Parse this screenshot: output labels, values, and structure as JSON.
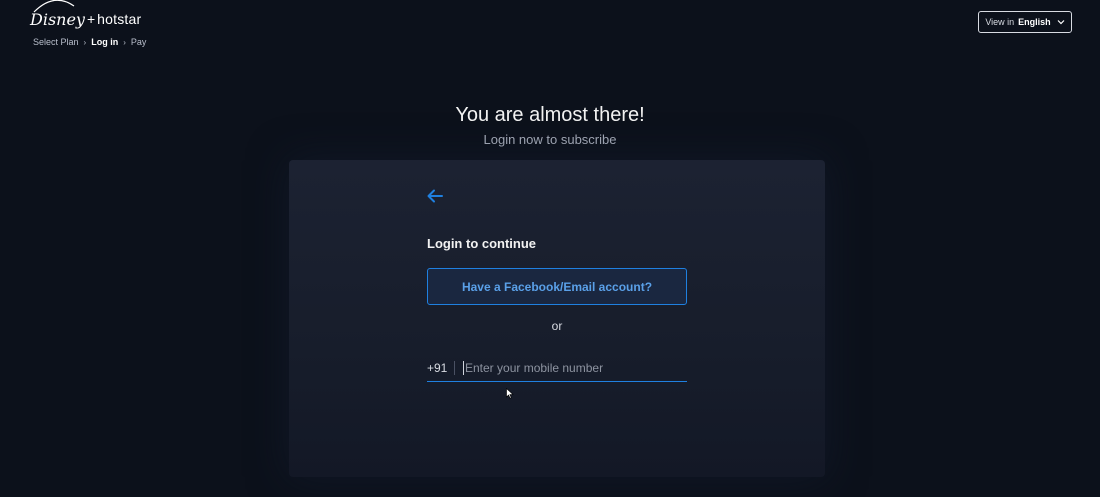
{
  "header": {
    "logo": {
      "brand_text": "Disney",
      "plus": "+",
      "hotstar": "hotstar"
    },
    "breadcrumb": [
      {
        "label": "Select Plan",
        "active": false
      },
      {
        "label": "Log in",
        "active": true
      },
      {
        "label": "Pay",
        "active": false
      }
    ],
    "language_button": {
      "prefix": "View in",
      "language": "English",
      "icon": "chevron-down-icon"
    }
  },
  "main": {
    "title": "You are almost there!",
    "subtitle": "Login now to subscribe"
  },
  "login_card": {
    "back_icon": "arrow-left-icon",
    "heading": "Login to continue",
    "facebook_email_button": "Have a Facebook/Email account?",
    "or_text": "or",
    "phone": {
      "country_code": "+91",
      "placeholder": "Enter your mobile number",
      "value": ""
    }
  },
  "colors": {
    "background": "#0c111b",
    "accent": "#1f80e0",
    "card": "#1c2232"
  }
}
